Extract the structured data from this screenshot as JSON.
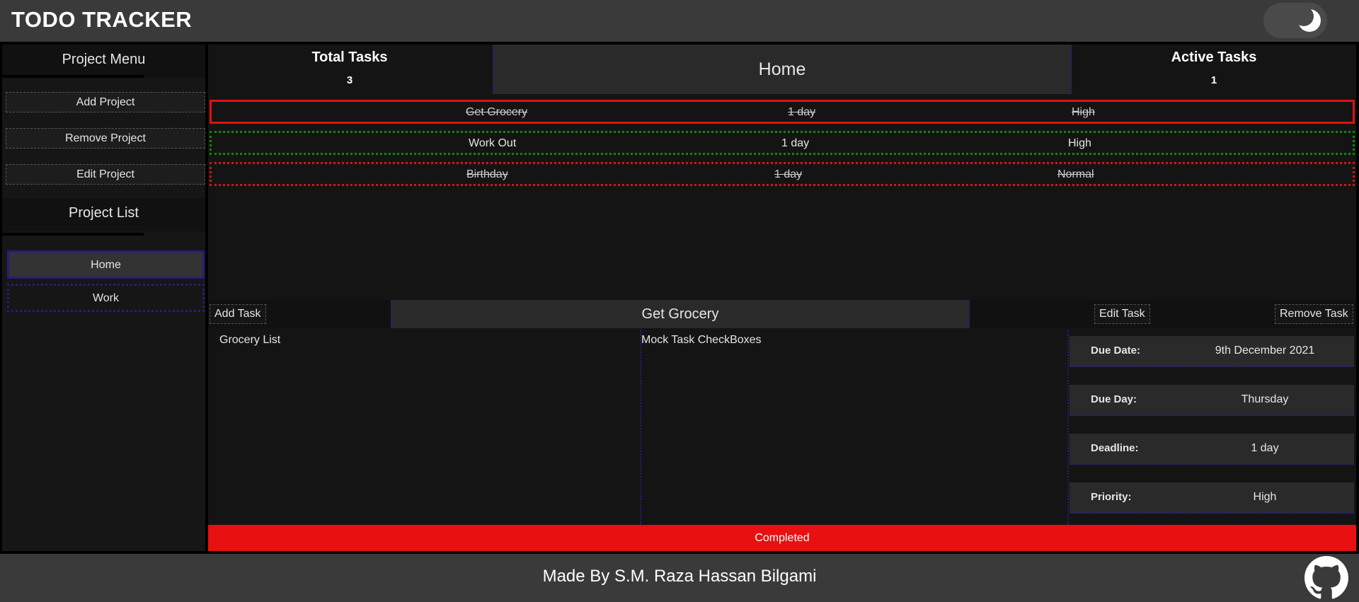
{
  "header": {
    "title": "TODO TRACKER",
    "theme_toggle_icon": "moon-icon"
  },
  "sidebar": {
    "menu_heading": "Project Menu",
    "menu_buttons": [
      {
        "label": "Add Project"
      },
      {
        "label": "Remove Project"
      },
      {
        "label": "Edit Project"
      }
    ],
    "list_heading": "Project List",
    "projects": [
      {
        "label": "Home",
        "active": true
      },
      {
        "label": "Work",
        "active": false
      }
    ]
  },
  "stats": {
    "total_label": "Total Tasks",
    "total_value": "3",
    "active_label": "Active Tasks",
    "active_value": "1"
  },
  "current_project": "Home",
  "tasks": [
    {
      "name": "Get Grocery",
      "deadline": "1 day",
      "priority": "High",
      "completed": true,
      "selected": true
    },
    {
      "name": "Work Out",
      "deadline": "1 day",
      "priority": "High",
      "completed": false,
      "selected": false
    },
    {
      "name": "Birthday",
      "deadline": "1 day",
      "priority": "Normal",
      "completed": true,
      "selected": false
    }
  ],
  "task_toolbar": {
    "add_label": "Add Task",
    "title": "Get Grocery",
    "edit_label": "Edit Task",
    "remove_label": "Remove Task"
  },
  "task_detail": {
    "description": "Grocery List",
    "checklist_title": "Mock Task CheckBoxes",
    "fields": [
      {
        "label": "Due Date:",
        "value": "9th December 2021"
      },
      {
        "label": "Due Day:",
        "value": "Thursday"
      },
      {
        "label": "Deadline:",
        "value": "1 day"
      },
      {
        "label": "Priority:",
        "value": "High"
      }
    ],
    "status_label": "Completed"
  },
  "footer": {
    "credit": "Made By S.M. Raza Hassan Bilgami",
    "icon": "github-icon"
  },
  "colors": {
    "status_red": "#e81010",
    "accent_purple": "#2b1b7a",
    "active_green": "#0a8a0a"
  }
}
